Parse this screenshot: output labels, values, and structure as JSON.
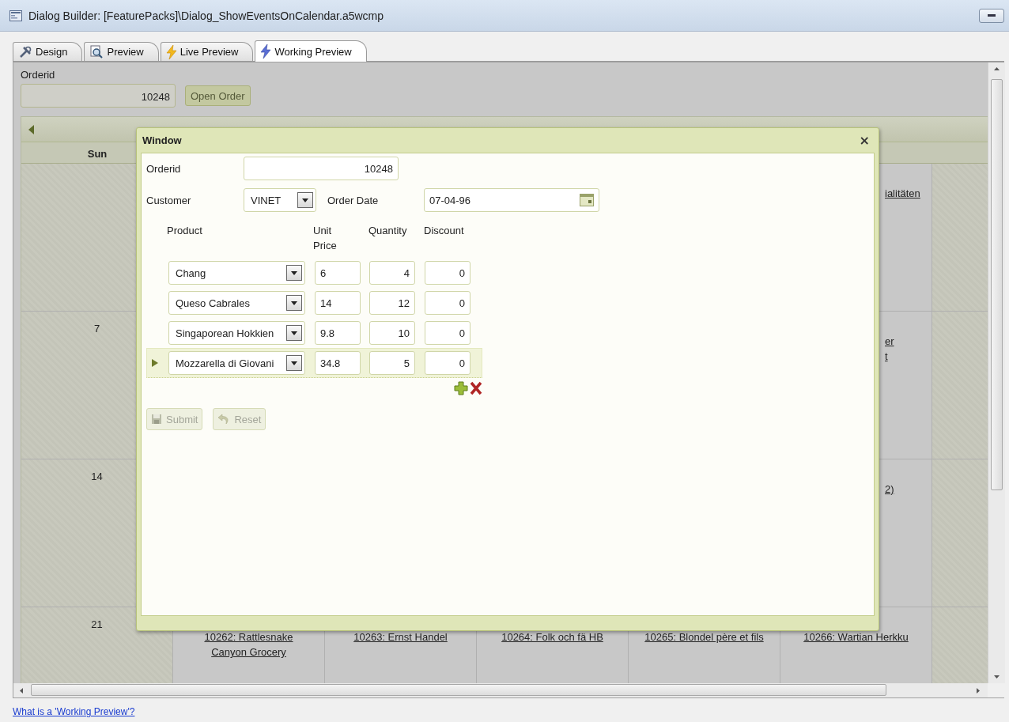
{
  "window": {
    "title": "Dialog Builder: [FeaturePacks]\\Dialog_ShowEventsOnCalendar.a5wcmp"
  },
  "tabs": [
    {
      "label": "Design",
      "kind": "tools",
      "selected": false
    },
    {
      "label": "Preview",
      "kind": "magnifier",
      "selected": false
    },
    {
      "label": "Live Preview",
      "kind": "bolt",
      "selected": false
    },
    {
      "label": "Working Preview",
      "kind": "bolt-blue",
      "selected": true
    }
  ],
  "form": {
    "orderid_label": "Orderid",
    "orderid_value": "10248",
    "open_button": "Open Order"
  },
  "calendar": {
    "day_header": "Sun",
    "weeks": [
      {
        "friday_fragment": [
          "ialitäten"
        ]
      },
      {
        "day_number": "7",
        "friday_fragment": [
          "er",
          "t"
        ]
      },
      {
        "day_number": "14",
        "friday_fragment": [
          "2)"
        ]
      },
      {
        "day_number": "21",
        "events": [
          [
            "10262: Rattlesnake",
            "Canyon Grocery"
          ],
          [
            "10263: Ernst Handel"
          ],
          [
            "10264: Folk och fä HB"
          ],
          [
            "10265: Blondel père et fils"
          ],
          [
            "10266: Wartian Herkku"
          ]
        ]
      }
    ]
  },
  "dialog": {
    "title": "Window",
    "close": "×",
    "orderid_label": "Orderid",
    "orderid_value": "10248",
    "customer_label": "Customer",
    "customer_value": "VINET",
    "order_date_label": "Order Date",
    "order_date_value": "07-04-96",
    "columns": [
      "Product",
      "Unit Price",
      "Quantity",
      "Discount"
    ],
    "rows": [
      {
        "product": "Chang",
        "unit_price": "6",
        "quantity": "4",
        "discount": "0",
        "selected": false
      },
      {
        "product": "Queso Cabrales",
        "unit_price": "14",
        "quantity": "12",
        "discount": "0",
        "selected": false
      },
      {
        "product": "Singaporean Hokkien",
        "unit_price": "9.8",
        "quantity": "10",
        "discount": "0",
        "selected": false
      },
      {
        "product": "Mozzarella di Giovani",
        "unit_price": "34.8",
        "quantity": "5",
        "discount": "0",
        "selected": true
      }
    ],
    "buttons": [
      {
        "label": "Submit",
        "kind": "save",
        "disabled": true
      },
      {
        "label": "Reset",
        "kind": "undo",
        "disabled": true
      }
    ]
  },
  "footer_link": "What is a 'Working Preview'?"
}
